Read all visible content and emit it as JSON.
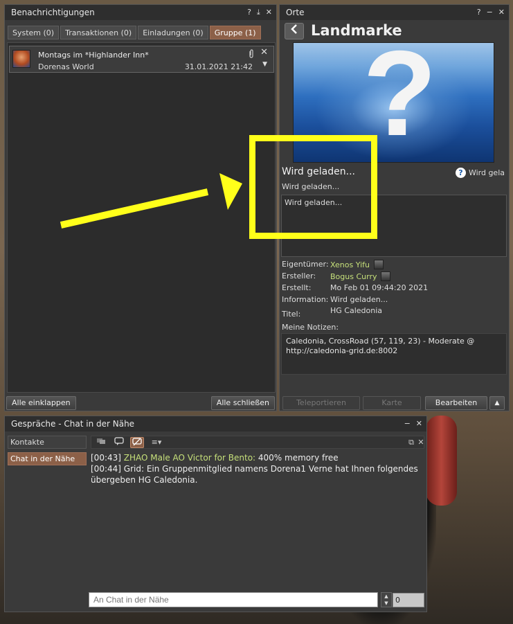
{
  "notifications": {
    "title": "Benachrichtigungen",
    "controls": {
      "help": "?",
      "dock": "⤓",
      "close": "✕"
    },
    "tabs": [
      {
        "label": "System (0)",
        "active": false
      },
      {
        "label": "Transaktionen (0)",
        "active": false
      },
      {
        "label": "Einladungen (0)",
        "active": false
      },
      {
        "label": "Gruppe (1)",
        "active": true
      }
    ],
    "items": [
      {
        "subject": "Montags im *Highlander Inn*",
        "from": "Dorenas World",
        "date": "31.01.2021 21:42"
      }
    ],
    "collapse_all": "Alle einklappen",
    "close_all": "Alle schließen"
  },
  "places": {
    "title": "Orte",
    "controls": {
      "help": "?",
      "minimize": "−",
      "close": "✕"
    },
    "heading": "Landmarke",
    "image_placeholder": "?",
    "parcel_name": "Wird geladen...",
    "maturity_label": "Wird gela",
    "region": "Wird geladen...",
    "description": "Wird geladen...",
    "info": {
      "owner_label": "Eigentümer:",
      "owner_value": "Xenos Yifu",
      "creator_label": "Ersteller:",
      "creator_value": "Bogus Curry",
      "created_label": "Erstellt:",
      "created_value": "Mo Feb 01 09:44:20 2021",
      "information_label": "Information:",
      "information_value": "Wird geladen...",
      "title_label": "Titel:",
      "title_value": "HG Caledonia",
      "notes_label": "Meine Notizen:"
    },
    "notes": "Caledonia, CrossRoad (57, 119, 23) - Moderate @ http://caledonia-grid.de:8002",
    "buttons": {
      "teleport": "Teleportieren",
      "map": "Karte",
      "edit": "Bearbeiten",
      "more": "▲"
    }
  },
  "chat": {
    "title": "Gespräche - Chat in der Nähe",
    "controls": {
      "minimize": "−",
      "close": "✕"
    },
    "contacts": "Kontakte",
    "nearby": "Chat in der Nähe",
    "messages": [
      {
        "time": "[00:43]",
        "name": "ZHAO Male AO Victor for Bento:",
        "text": "400% memory free"
      },
      {
        "time": "[00:44]",
        "name": "",
        "text": "Grid: Ein Gruppenmitglied namens Dorena1 Verne hat Ihnen folgendes übergeben HG Caledonia."
      }
    ],
    "input_placeholder": "An Chat in der Nähe",
    "channel": "0"
  },
  "colors": {
    "accent": "#8c6048",
    "link_green": "#c6e07a",
    "highlight_yellow": "#ffff1a"
  }
}
